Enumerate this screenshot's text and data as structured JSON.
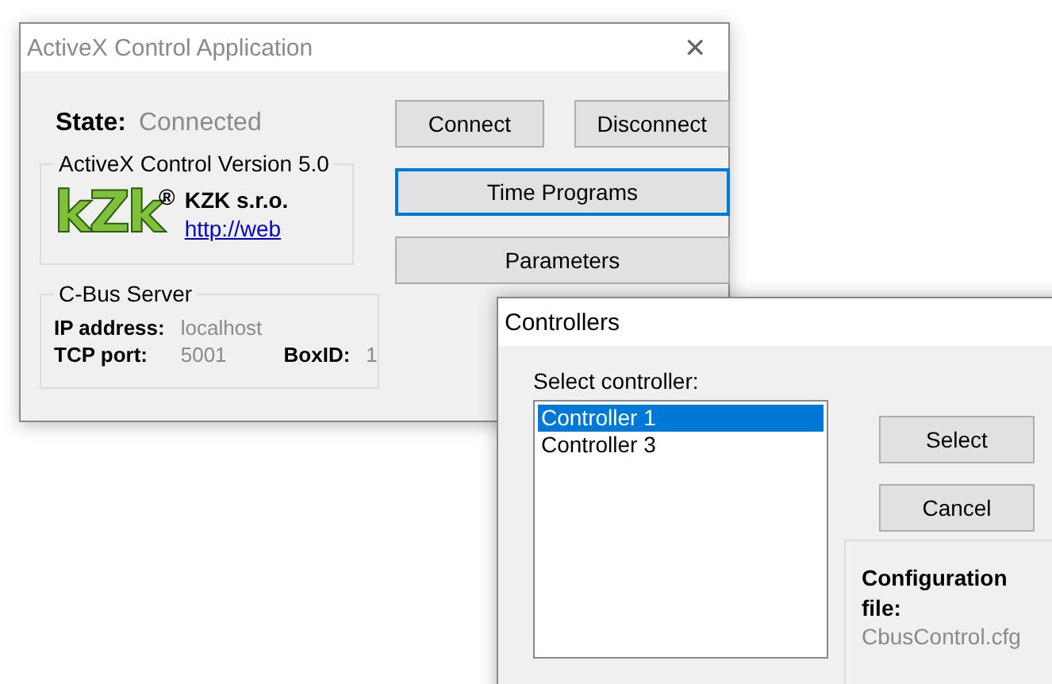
{
  "main_window": {
    "title": "ActiveX Control Application",
    "close": "✕",
    "state": {
      "label": "State:",
      "value": "Connected"
    },
    "buttons": [
      {
        "label": "Connect",
        "focused": false
      },
      {
        "label": "Disconnect",
        "focused": false
      },
      {
        "label": "Time Programs",
        "focused": true
      },
      {
        "label": "Parameters",
        "focused": false
      }
    ],
    "version_group": {
      "title": "ActiveX Control Version 5.0",
      "logo": "kZk",
      "registered": "®",
      "company": "KZK s.r.o.",
      "link": "http://web"
    },
    "server_group": {
      "title": "C-Bus Server",
      "ip_label": "IP address:",
      "ip_value": "localhost",
      "port_label": "TCP port:",
      "port_value": "5001",
      "box_label": "BoxID:",
      "box_value": "1"
    }
  },
  "controllers_dialog": {
    "title": "Controllers",
    "list_label": "Select controller:",
    "items": [
      {
        "label": "Controller 1",
        "selected": true
      },
      {
        "label": "Controller 3",
        "selected": false
      }
    ],
    "buttons": [
      "Select",
      "Cancel"
    ],
    "config": {
      "label": "Configuration file:",
      "value": "CbusControl.cfg"
    }
  }
}
